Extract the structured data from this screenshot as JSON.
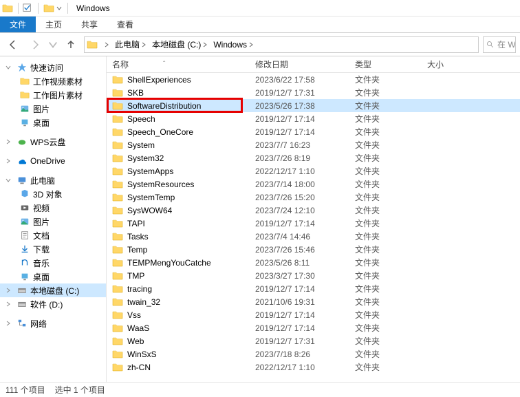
{
  "title": "Windows",
  "ribbon": {
    "file": "文件",
    "home": "主页",
    "share": "共享",
    "view": "查看"
  },
  "breadcrumbs": [
    "此电脑",
    "本地磁盘 (C:)",
    "Windows"
  ],
  "search_placeholder": "在 W",
  "sidebar": {
    "quick": {
      "label": "快速访问",
      "items": [
        "工作视频素材",
        "工作图片素材",
        "图片",
        "桌面"
      ]
    },
    "wps": "WPS云盘",
    "onedrive": "OneDrive",
    "thispc": {
      "label": "此电脑",
      "items": [
        "3D 对象",
        "视频",
        "图片",
        "文档",
        "下载",
        "音乐",
        "桌面",
        "本地磁盘 (C:)",
        "软件 (D:)"
      ]
    },
    "network": "网络"
  },
  "columns": {
    "name": "名称",
    "date": "修改日期",
    "type": "类型",
    "size": "大小"
  },
  "folder_type": "文件夹",
  "files": [
    {
      "name": "ShellExperiences",
      "date": "2023/6/22 17:58"
    },
    {
      "name": "SKB",
      "date": "2019/12/7 17:31"
    },
    {
      "name": "SoftwareDistribution",
      "date": "2023/5/26 17:38",
      "selected": true,
      "highlight": true
    },
    {
      "name": "Speech",
      "date": "2019/12/7 17:14"
    },
    {
      "name": "Speech_OneCore",
      "date": "2019/12/7 17:14"
    },
    {
      "name": "System",
      "date": "2023/7/7 16:23"
    },
    {
      "name": "System32",
      "date": "2023/7/26 8:19"
    },
    {
      "name": "SystemApps",
      "date": "2022/12/17 1:10"
    },
    {
      "name": "SystemResources",
      "date": "2023/7/14 18:00"
    },
    {
      "name": "SystemTemp",
      "date": "2023/7/26 15:20"
    },
    {
      "name": "SysWOW64",
      "date": "2023/7/24 12:10"
    },
    {
      "name": "TAPI",
      "date": "2019/12/7 17:14"
    },
    {
      "name": "Tasks",
      "date": "2023/7/4 14:46"
    },
    {
      "name": "Temp",
      "date": "2023/7/26 15:46"
    },
    {
      "name": "TEMPMengYouCatche",
      "date": "2023/5/26 8:11"
    },
    {
      "name": "TMP",
      "date": "2023/3/27 17:30"
    },
    {
      "name": "tracing",
      "date": "2019/12/7 17:14"
    },
    {
      "name": "twain_32",
      "date": "2021/10/6 19:31"
    },
    {
      "name": "Vss",
      "date": "2019/12/7 17:14"
    },
    {
      "name": "WaaS",
      "date": "2019/12/7 17:14"
    },
    {
      "name": "Web",
      "date": "2019/12/7 17:31"
    },
    {
      "name": "WinSxS",
      "date": "2023/7/18 8:26"
    },
    {
      "name": "zh-CN",
      "date": "2022/12/17 1:10"
    }
  ],
  "status": {
    "count": "111 个项目",
    "selected": "选中 1 个项目"
  }
}
